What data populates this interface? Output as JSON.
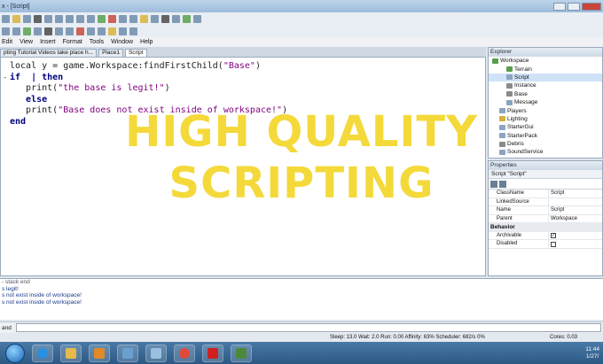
{
  "window": {
    "title": "x - [Script]"
  },
  "menu": [
    "Edit",
    "View",
    "Insert",
    "Format",
    "Tools",
    "Window",
    "Help"
  ],
  "tabs": [
    {
      "label": "pting Tutorial Videos take place h...",
      "active": false
    },
    {
      "label": "Place1",
      "active": false
    },
    {
      "label": "Script",
      "active": true
    }
  ],
  "editor": {
    "lines": [
      "local y = game.Workspace:findFirstChild(\"Base\")",
      "if  | then",
      "   print(\"the base is legit!\")",
      "   else",
      "   print(\"Base does not exist inside of workspace!\")",
      "end"
    ],
    "fold_marker": "-"
  },
  "explorer": {
    "title": "Explorer",
    "items": [
      {
        "label": "Workspace",
        "indent": 0,
        "icon": "globe-icon"
      },
      {
        "label": "Terrain",
        "indent": 2,
        "icon": "terrain-icon"
      },
      {
        "label": "Script",
        "indent": 2,
        "icon": "script-icon",
        "selected": true
      },
      {
        "label": "Instance",
        "indent": 2,
        "icon": "instance-icon"
      },
      {
        "label": "Base",
        "indent": 2,
        "icon": "part-icon"
      },
      {
        "label": "Message",
        "indent": 2,
        "icon": "message-icon"
      },
      {
        "label": "Players",
        "indent": 1,
        "icon": "players-icon"
      },
      {
        "label": "Lighting",
        "indent": 1,
        "icon": "lighting-icon"
      },
      {
        "label": "StarterGui",
        "indent": 1,
        "icon": "gui-icon"
      },
      {
        "label": "StarterPack",
        "indent": 1,
        "icon": "pack-icon"
      },
      {
        "label": "Debris",
        "indent": 1,
        "icon": "debris-icon"
      },
      {
        "label": "SoundService",
        "indent": 1,
        "icon": "sound-icon"
      }
    ]
  },
  "properties": {
    "title": "Properties",
    "subject": "Script \"Script\"",
    "rows": [
      {
        "key": "ClassName",
        "value": "Script"
      },
      {
        "key": "LinkedSource",
        "value": ""
      },
      {
        "key": "Name",
        "value": "Script"
      },
      {
        "key": "Parent",
        "value": "Workspace"
      }
    ],
    "category": "Behavior",
    "behavior": [
      {
        "key": "Archivable",
        "checked": true
      },
      {
        "key": "Disabled",
        "checked": false
      }
    ]
  },
  "output": {
    "lines": [
      "- stack end",
      "s legit!",
      "s not exist inside of workspace!",
      "s not exist inside of workspace!"
    ]
  },
  "command_bar": {
    "label": "and"
  },
  "status": {
    "stats": "Sleep: 13.0  Wait: 2.0  Run: 0.00  Affinity: 63%  Scheduler: 682/s 0%",
    "cores": "Cores: 0.03"
  },
  "overlay": {
    "line1": "HIGH QUALITY",
    "line2": "SCRIPTING"
  },
  "clock": {
    "time": "11:44",
    "date": "1/27/"
  }
}
